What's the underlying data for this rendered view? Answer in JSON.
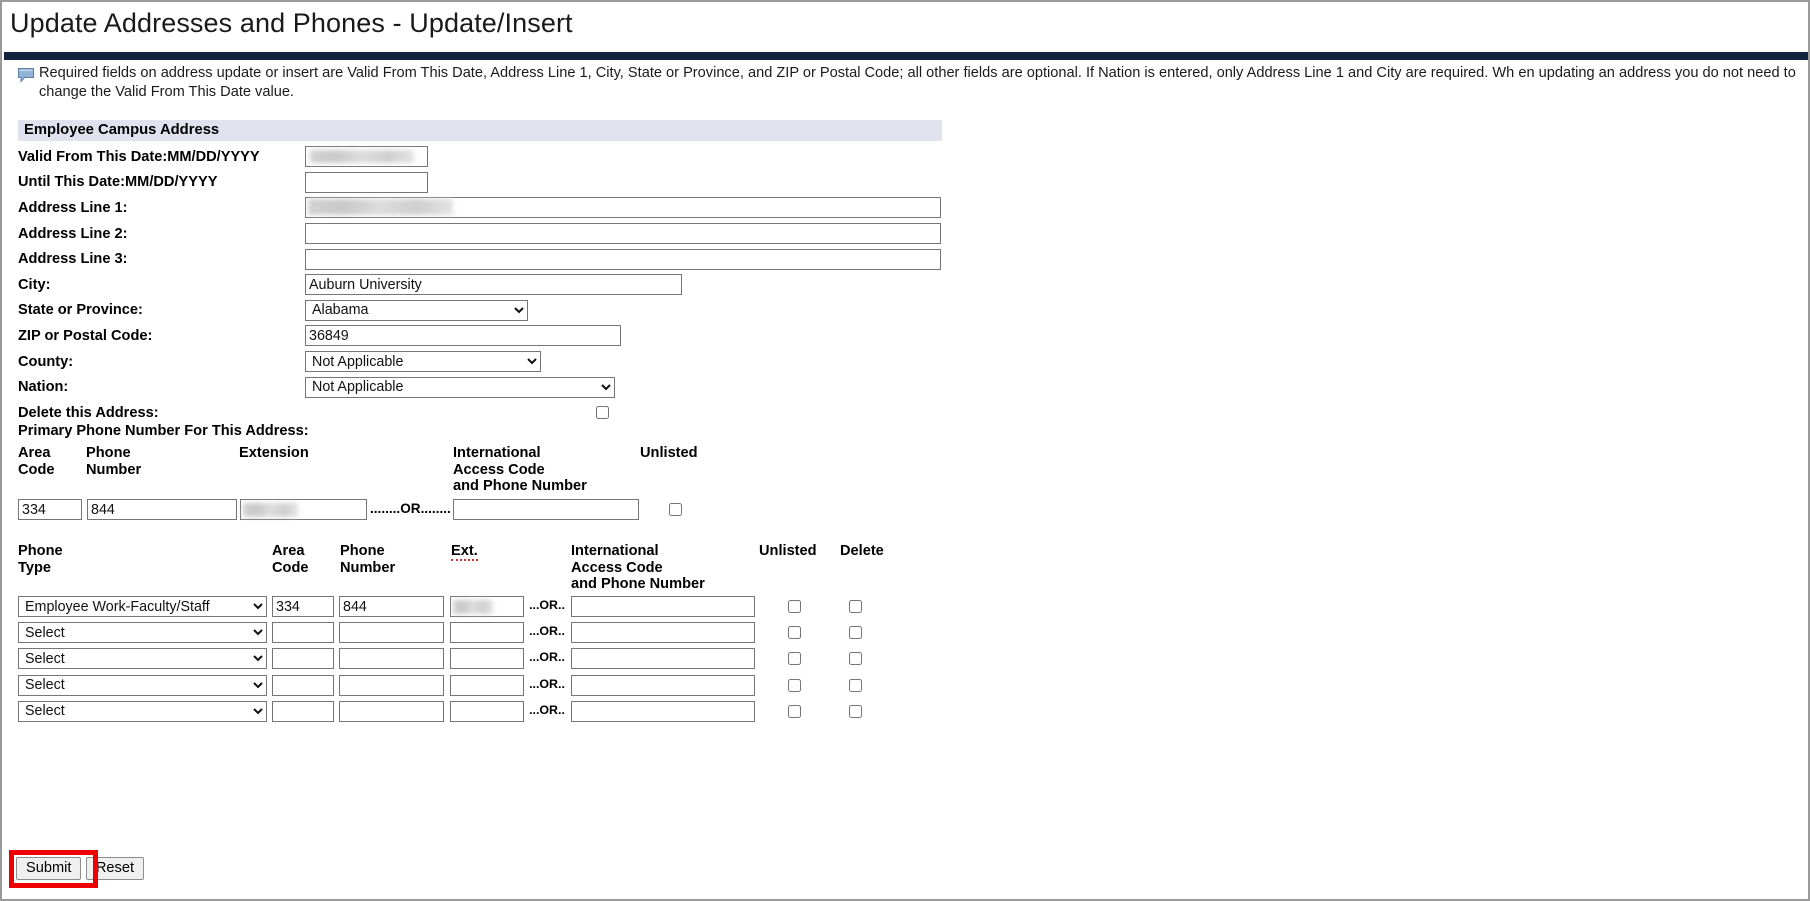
{
  "page": {
    "title": "Update Addresses and Phones - Update/Insert",
    "info_icon": "callout-bubble-icon",
    "info_text": "Required fields on address update or insert are Valid From This Date, Address Line 1, City, State or Province, and ZIP or Postal Code; all other fields are optional. If Nation is entered, only Address Line 1 and City are required. Wh en updating an address you do not need to change the Valid From This Date value."
  },
  "section": {
    "header": "Employee Campus Address"
  },
  "address_fields": {
    "valid_from_label": "Valid From This Date:MM/DD/YYYY",
    "valid_from_value": "",
    "until_label": "Until This Date:MM/DD/YYYY",
    "until_value": "",
    "line1_label": "Address Line 1:",
    "line1_value": "",
    "line2_label": "Address Line 2:",
    "line2_value": "",
    "line3_label": "Address Line 3:",
    "line3_value": "",
    "city_label": "City:",
    "city_value": "Auburn University",
    "state_label": "State or Province:",
    "state_value": "Alabama",
    "zip_label": "ZIP or Postal Code:",
    "zip_value": "36849",
    "county_label": "County:",
    "county_value": "Not Applicable",
    "nation_label": "Nation:",
    "nation_value": "Not Applicable",
    "delete_label": "Delete this Address:",
    "delete_checked": false
  },
  "primary_phone": {
    "title": "Primary Phone Number For This Address:",
    "headers": {
      "area_code": "Area\nCode",
      "area_code_l1": "Area",
      "area_code_l2": "Code",
      "phone_number_l1": "Phone",
      "phone_number_l2": "Number",
      "extension": "Extension",
      "international_l1": "International",
      "international_l2": "Access Code",
      "international_l3": "and Phone Number",
      "unlisted": "Unlisted"
    },
    "or_separator": "........OR........",
    "values": {
      "area_code": "334",
      "phone_number": "844",
      "extension": "",
      "international": "",
      "unlisted_checked": false
    }
  },
  "phone_table": {
    "headers": {
      "phone_type": "Phone Type",
      "area_code_l1": "Area",
      "area_code_l2": "Code",
      "phone_number_l1": "Phone",
      "phone_number_l2": "Number",
      "ext": "Ext.",
      "international_l1": "International",
      "international_l2": "Access Code",
      "international_l3": "and Phone Number",
      "unlisted": "Unlisted",
      "delete": "Delete"
    },
    "or_separator": "...OR..",
    "rows": [
      {
        "phone_type": "Employee Work-Faculty/Staff",
        "area_code": "334",
        "phone_number": "844",
        "ext": "",
        "international": "",
        "unlisted_checked": false,
        "delete_checked": false
      },
      {
        "phone_type": "Select",
        "area_code": "",
        "phone_number": "",
        "ext": "",
        "international": "",
        "unlisted_checked": false,
        "delete_checked": false
      },
      {
        "phone_type": "Select",
        "area_code": "",
        "phone_number": "",
        "ext": "",
        "international": "",
        "unlisted_checked": false,
        "delete_checked": false
      },
      {
        "phone_type": "Select",
        "area_code": "",
        "phone_number": "",
        "ext": "",
        "international": "",
        "unlisted_checked": false,
        "delete_checked": false
      },
      {
        "phone_type": "Select",
        "area_code": "",
        "phone_number": "",
        "ext": "",
        "international": "",
        "unlisted_checked": false,
        "delete_checked": false
      }
    ]
  },
  "buttons": {
    "submit": "Submit",
    "reset": "Reset",
    "highlight_color": "#ef0000"
  },
  "colors": {
    "rule_bar": "#12233f",
    "section_band": "#e0e3ee",
    "highlight": "#ef0000"
  }
}
